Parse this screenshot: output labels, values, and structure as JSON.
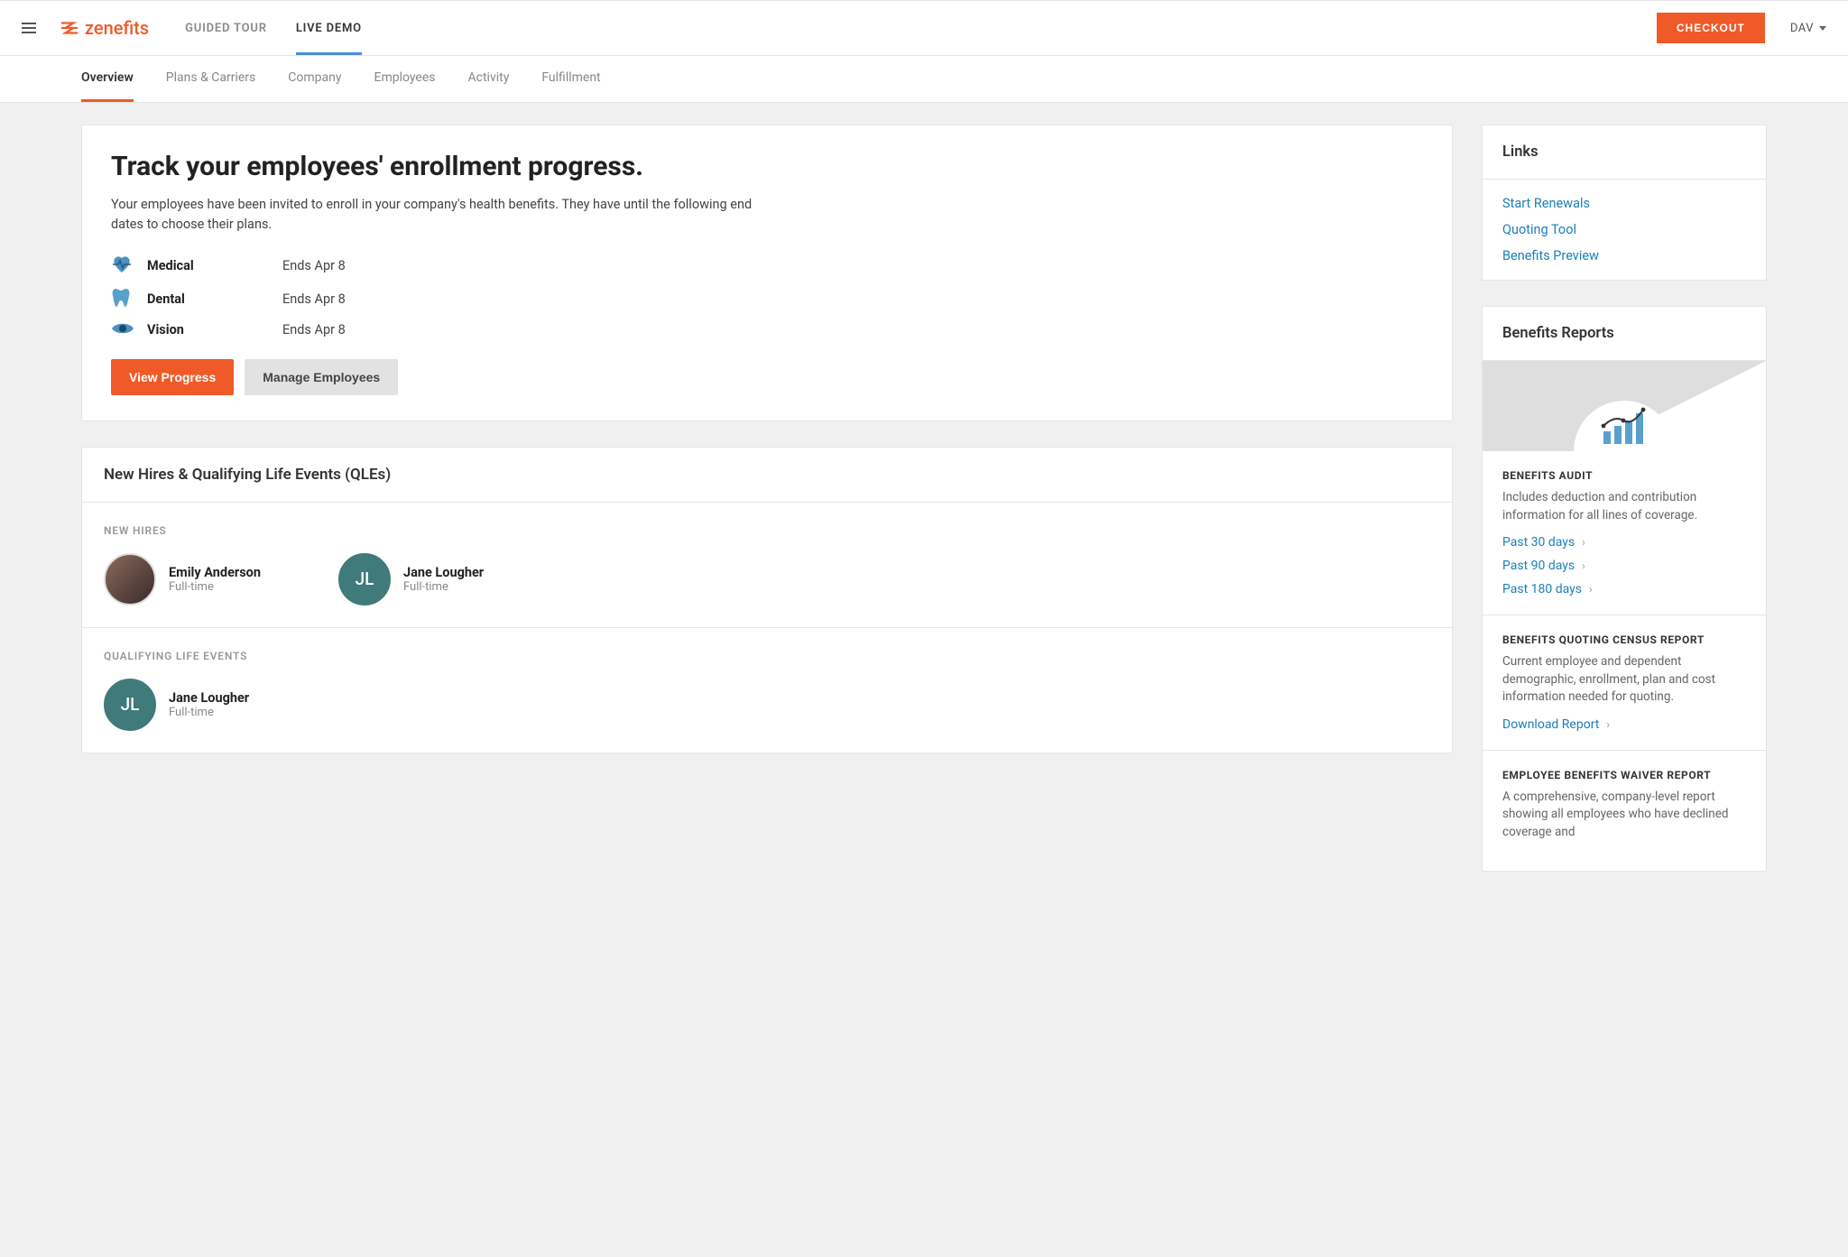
{
  "brand": "zenefits",
  "topnav": {
    "items": [
      "GUIDED TOUR",
      "LIVE DEMO"
    ],
    "active": 1
  },
  "checkout_label": "CHECKOUT",
  "user_label": "DAV",
  "subnav": {
    "items": [
      "Overview",
      "Plans & Carriers",
      "Company",
      "Employees",
      "Activity",
      "Fulfillment"
    ],
    "active": 0
  },
  "main": {
    "title": "Track your employees' enrollment progress.",
    "lead": "Your employees have been invited to enroll in your company's health benefits. They have until the following end dates to choose their plans.",
    "benefits": [
      {
        "name": "Medical",
        "end": "Ends Apr 8",
        "icon": "heartbeat"
      },
      {
        "name": "Dental",
        "end": "Ends Apr 8",
        "icon": "tooth"
      },
      {
        "name": "Vision",
        "end": "Ends Apr 8",
        "icon": "eye"
      }
    ],
    "view_progress_label": "View Progress",
    "manage_employees_label": "Manage Employees"
  },
  "hires_section": {
    "title": "New Hires & Qualifying Life Events (QLEs)",
    "new_hires_label": "NEW HIRES",
    "qle_label": "QUALIFYING LIFE EVENTS",
    "new_hires": [
      {
        "name": "Emily Anderson",
        "sub": "Full-time",
        "avatar_type": "photo",
        "initials": ""
      },
      {
        "name": "Jane Lougher",
        "sub": "Full-time",
        "avatar_type": "teal",
        "initials": "JL"
      }
    ],
    "qles": [
      {
        "name": "Jane Lougher",
        "sub": "Full-time",
        "avatar_type": "teal",
        "initials": "JL"
      }
    ]
  },
  "links_panel": {
    "title": "Links",
    "items": [
      "Start Renewals",
      "Quoting Tool",
      "Benefits Preview"
    ]
  },
  "reports_panel": {
    "title": "Benefits Reports",
    "blocks": [
      {
        "title": "BENEFITS AUDIT",
        "desc": "Includes deduction and contribution information for all lines of coverage.",
        "links": [
          "Past 30 days",
          "Past 90 days",
          "Past 180 days"
        ]
      },
      {
        "title": "BENEFITS QUOTING CENSUS REPORT",
        "desc": "Current employee and dependent demographic, enrollment, plan and cost information needed for quoting.",
        "links": [
          "Download Report"
        ]
      },
      {
        "title": "EMPLOYEE BENEFITS WAIVER REPORT",
        "desc": "A comprehensive, company-level report showing all employees who have declined coverage and",
        "links": []
      }
    ]
  }
}
